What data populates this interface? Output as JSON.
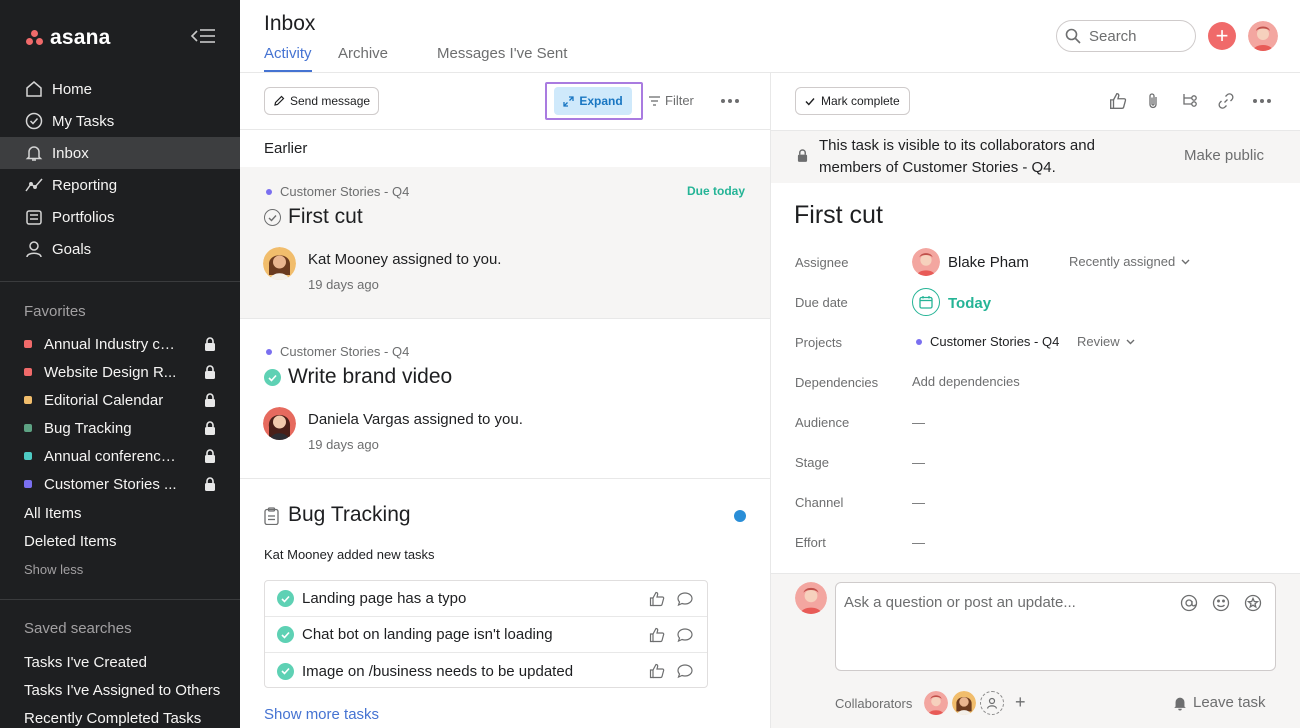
{
  "app": {
    "name": "asana",
    "brand_color": "#f06a6a"
  },
  "sidebar": {
    "nav": [
      {
        "label": "Home",
        "icon": "home-icon"
      },
      {
        "label": "My Tasks",
        "icon": "check-circle-icon"
      },
      {
        "label": "Inbox",
        "icon": "bell-icon",
        "active": true
      },
      {
        "label": "Reporting",
        "icon": "chart-line-icon"
      },
      {
        "label": "Portfolios",
        "icon": "folder-icon"
      },
      {
        "label": "Goals",
        "icon": "person-icon"
      }
    ],
    "favorites_heading": "Favorites",
    "favorites": [
      {
        "label": "Annual Industry co...",
        "color": "#f06a6a"
      },
      {
        "label": "Website Design R...",
        "color": "#f06a6a"
      },
      {
        "label": "Editorial Calendar",
        "color": "#f1bd6c"
      },
      {
        "label": "Bug Tracking",
        "color": "#5da283"
      },
      {
        "label": "Annual conference...",
        "color": "#4ecbc4"
      },
      {
        "label": "Customer Stories ...",
        "color": "#7a6ff0"
      }
    ],
    "all_items": "All Items",
    "deleted_items": "Deleted Items",
    "show_less": "Show less",
    "saved_heading": "Saved searches",
    "saved": [
      "Tasks I've Created",
      "Tasks I've Assigned to Others",
      "Recently Completed Tasks"
    ]
  },
  "header": {
    "title": "Inbox",
    "tabs": [
      "Activity",
      "Archive",
      "Messages I've Sent"
    ],
    "search_placeholder": "Search",
    "plus": "+"
  },
  "inbox": {
    "toolbar": {
      "send_message": "Send message",
      "expand": "Expand",
      "filter": "Filter"
    },
    "section_label": "Earlier",
    "items": [
      {
        "project": "Customer Stories - Q4",
        "due": "Due today",
        "title": "First cut",
        "actor": "Kat Mooney",
        "action": " assigned to you.",
        "time": "19 days ago"
      },
      {
        "project": "Customer Stories - Q4",
        "title": "Write brand video",
        "actor": "Daniela Vargas",
        "action": " assigned to you.",
        "time": "19 days ago"
      }
    ],
    "bug_tracking": {
      "title": "Bug Tracking",
      "added_text": "Kat Mooney added new tasks",
      "subtasks": [
        "Landing page has a typo",
        "Chat bot on landing page isn't loading",
        "Image on /business needs to be updated"
      ],
      "show_more": "Show more tasks"
    }
  },
  "detail": {
    "mark_complete": "Mark complete",
    "visibility_text": "This task is visible to its collaborators and members of Customer Stories - Q4.",
    "make_public": "Make public",
    "title": "First cut",
    "fields": {
      "assignee_label": "Assignee",
      "assignee": "Blake Pham",
      "recently_assigned": "Recently assigned",
      "due_label": "Due date",
      "due": "Today",
      "projects_label": "Projects",
      "project": "Customer Stories - Q4",
      "section": "Review",
      "dependencies_label": "Dependencies",
      "add_dependencies": "Add dependencies",
      "audience_label": "Audience",
      "stage_label": "Stage",
      "channel_label": "Channel",
      "effort_label": "Effort",
      "empty": "—"
    },
    "comment_placeholder": "Ask a question or post an update...",
    "collaborators_label": "Collaborators",
    "leave_task": "Leave task"
  }
}
